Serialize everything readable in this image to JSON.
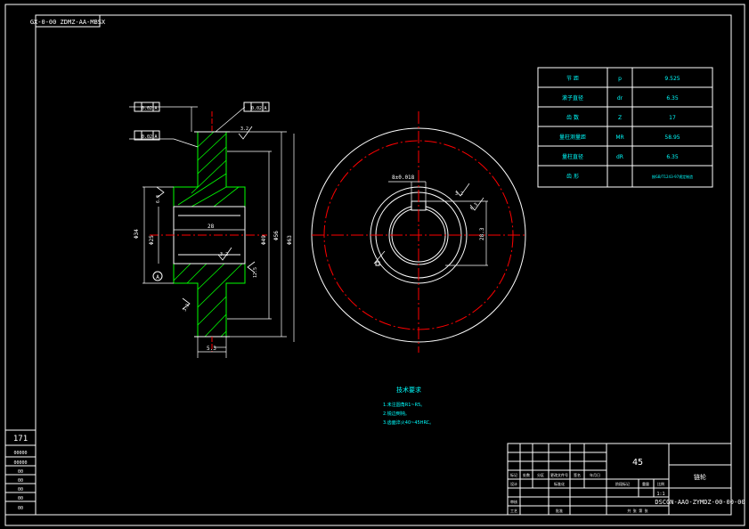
{
  "drawing_code_top": "GX-0-00 ZDMZ-AA-MBSX",
  "drawing_code_bottom": "DSCGN-AAO-ZYMDZ-00-00-00",
  "part_name": "链轮",
  "material": "45",
  "param_table": [
    {
      "name": "节 距",
      "symbol": "p",
      "value": "9.525"
    },
    {
      "name": "滚子直径",
      "symbol": "dr",
      "value": "6.35"
    },
    {
      "name": "齿 数",
      "symbol": "Z",
      "value": "17"
    },
    {
      "name": "量柱测量距",
      "symbol": "MR",
      "value": "58.95"
    },
    {
      "name": "量柱直径",
      "symbol": "dR",
      "value": "6.35"
    },
    {
      "name": "齿 形",
      "symbol": "",
      "value": "按GB/T1243-97规定制造"
    }
  ],
  "tech_notes": {
    "title": "技术要求",
    "lines": [
      "1.未注圆角R1~R5。",
      "2.锐边倒钝。",
      "3.齿面淬火40~45HRC。"
    ]
  },
  "title_block_labels": [
    "标记",
    "处数",
    "分区",
    "更改文件号",
    "签名",
    "年月日",
    "设计",
    "标准化",
    "审核",
    "工艺",
    "批准",
    "阶段标记",
    "重量",
    "比例",
    "共 张 第 张"
  ],
  "scale": "1:1",
  "side_labels": [
    "171",
    "00000",
    "00000",
    "00",
    "00",
    "00",
    "00",
    "00"
  ],
  "gd_frames": [
    "0.02",
    "0.02",
    "0.02"
  ],
  "datum": "A",
  "dims": {
    "bore": "Φ25",
    "hub": "Φ34",
    "width": "28",
    "tip": "Φ56",
    "od": "Φ63",
    "teeth_w": "5.3",
    "ra": [
      "3.2",
      "6.3",
      "3.2",
      "12.5",
      "3.2"
    ],
    "key": "8±0.018",
    "keydepth": "28.3",
    "root": "Φ49"
  }
}
